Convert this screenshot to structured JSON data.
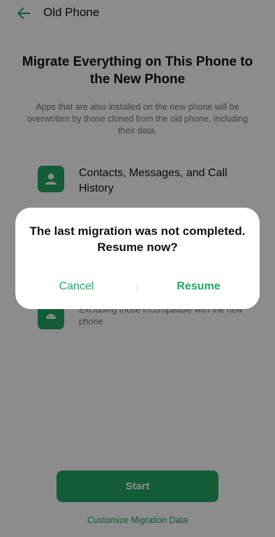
{
  "header": {
    "title": "Old Phone",
    "back_icon": "arrow-left-icon"
  },
  "main": {
    "title": "Migrate Everything on This Phone to the New Phone",
    "description": "Apps that are also installed on the new phone will be overwritten by those cloned from the old phone, including their data.",
    "items": [
      {
        "icon": "contact-icon",
        "title": "Contacts, Messages, and Call History",
        "subtitle": ""
      },
      {
        "icon": "android-icon",
        "title": "",
        "subtitle": "Excluding those incompatible with the new phone"
      }
    ]
  },
  "footer": {
    "start_label": "Start",
    "customize_label": "Customize Migration Data"
  },
  "dialog": {
    "message": "The last migration was not completed. Resume now?",
    "cancel_label": "Cancel",
    "resume_label": "Resume"
  },
  "colors": {
    "accent": "#21a864",
    "overlay": "#000000"
  }
}
